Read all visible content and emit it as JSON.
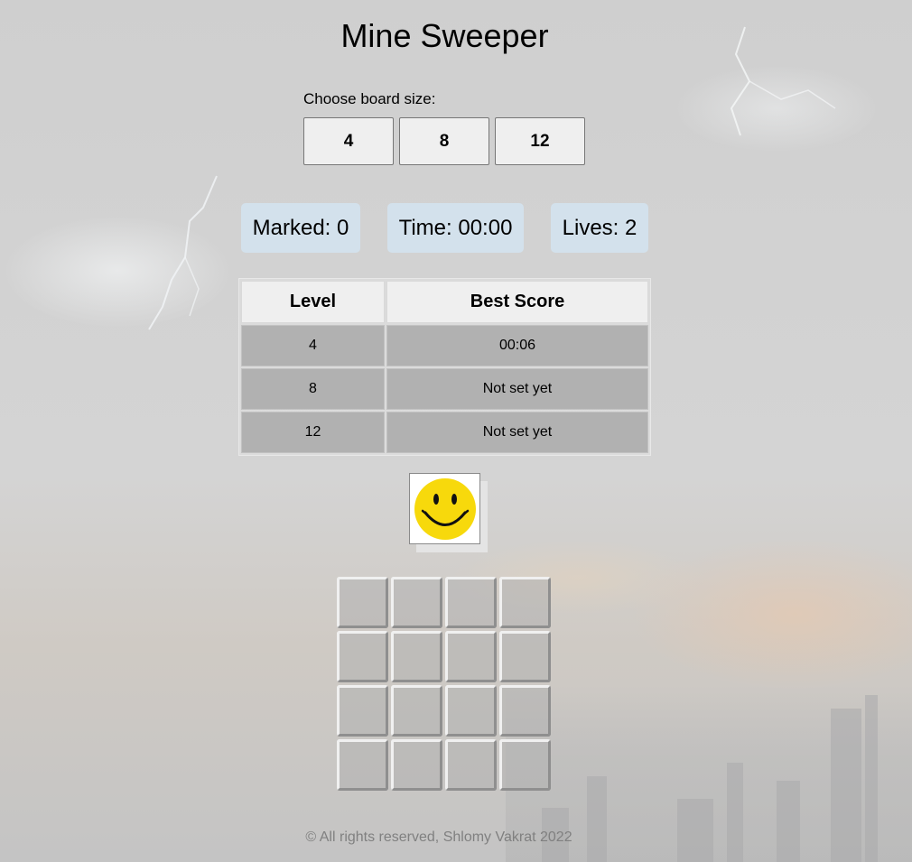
{
  "title": "Mine Sweeper",
  "board_size": {
    "prompt": "Choose board size:",
    "options": [
      "4",
      "8",
      "12"
    ]
  },
  "stats": {
    "marked": "Marked: 0",
    "time": "Time: 00:00",
    "lives": "Lives: 2"
  },
  "scores_table": {
    "headers": [
      "Level",
      "Best Score"
    ],
    "rows": [
      [
        "4",
        "00:06"
      ],
      [
        "8",
        "Not set yet"
      ],
      [
        "12",
        "Not set yet"
      ]
    ]
  },
  "smiley": {
    "icon": "smiley-icon",
    "face_color": "#f7d90c"
  },
  "board": {
    "rows": 4,
    "cols": 4
  },
  "footer": "© All rights reserved, Shlomy Vakrat 2022",
  "colors": {
    "stat_background": "#d3e1ec",
    "cell_background": "#b0b0b0"
  }
}
